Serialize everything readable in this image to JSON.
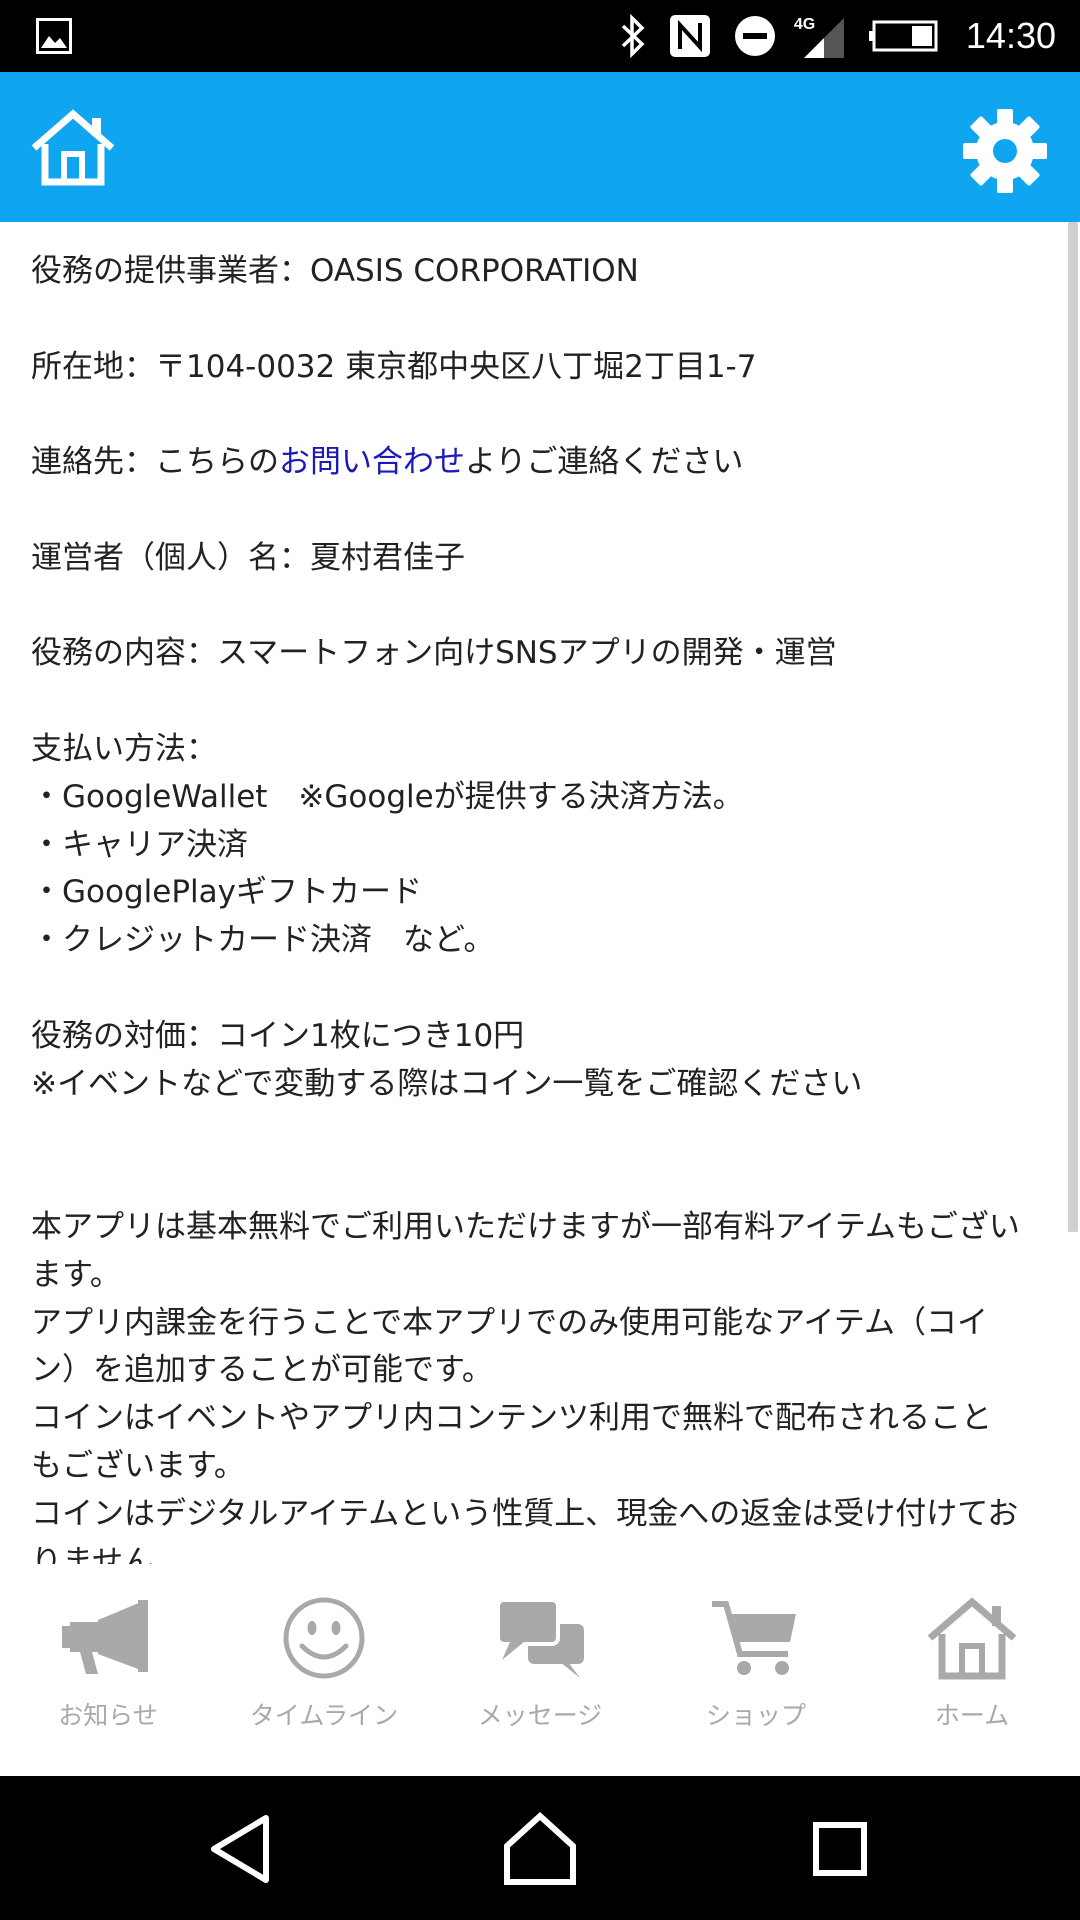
{
  "status_bar": {
    "time": "14:30",
    "network": "4G"
  },
  "content": {
    "provider": "役務の提供事業者：OASIS CORPORATION",
    "address": "所在地：〒104-0032 東京都中央区八丁堀2丁目1-7",
    "contact_prefix": "連絡先：こちらの",
    "contact_link": "お問い合わせ",
    "contact_suffix": "よりご連絡ください",
    "operator": "運営者（個人）名：夏村君佳子",
    "service": "役務の内容：スマートフォン向けSNSアプリの開発・運営",
    "payment_title": "支払い方法：",
    "payment_methods": [
      "・GoogleWallet　※Googleが提供する決済方法。",
      "・キャリア決済",
      "・GooglePlayギフトカード",
      "・クレジットカード決済　など。"
    ],
    "price": "役務の対価：コイン1枚につき10円",
    "price_note": "※イベントなどで変動する際はコイン一覧をご確認ください",
    "paragraphs": [
      "本アプリは基本無料でご利用いただけますが一部有料アイテムもございます。",
      "アプリ内課金を行うことで本アプリでのみ使用可能なアイテム（コイン）を追加することが可能です。",
      "コインはイベントやアプリ内コンテンツ利用で無料で配布されることもございます。",
      "コインはデジタルアイテムという性質上、現金への返金は受け付けておりません。"
    ]
  },
  "bottom_nav": {
    "items": [
      {
        "label": "お知らせ",
        "icon": "megaphone-icon"
      },
      {
        "label": "タイムライン",
        "icon": "smiley-icon"
      },
      {
        "label": "メッセージ",
        "icon": "chat-bubbles-icon"
      },
      {
        "label": "ショップ",
        "icon": "cart-icon"
      },
      {
        "label": "ホーム",
        "icon": "home-icon"
      }
    ]
  },
  "colors": {
    "header": "#0fa5f0",
    "link": "#1a1ab8",
    "nav_inactive": "#a9a9a9"
  }
}
